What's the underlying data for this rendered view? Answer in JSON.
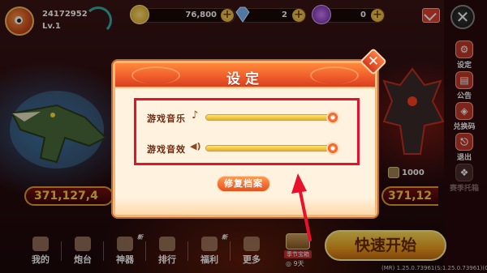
{
  "player": {
    "id": "24172952",
    "level": "Lv.1"
  },
  "currencies": [
    {
      "icon": "gold-coin-icon",
      "value": "76,800",
      "color": "#f0c020"
    },
    {
      "icon": "diamond-icon",
      "value": "2",
      "color": "#7ab8ff"
    },
    {
      "icon": "purple-gem-icon",
      "value": "0",
      "color": "#9a40d0"
    }
  ],
  "plus_glyph": "+",
  "side_menu": [
    {
      "icon": "gear-icon",
      "glyph": "⚙",
      "label": "设定"
    },
    {
      "icon": "announcement-icon",
      "glyph": "▤",
      "label": "公告"
    },
    {
      "icon": "redeem-code-icon",
      "glyph": "◈",
      "label": "兑换码"
    },
    {
      "icon": "exit-icon",
      "glyph": "⎋",
      "label": "退出"
    },
    {
      "icon": "season-icon",
      "glyph": "❖",
      "label": "赛季托箱"
    }
  ],
  "close_glyph": "✕",
  "payouts": {
    "left": "371,127,4",
    "right": "371,12",
    "small": "1000"
  },
  "dialog": {
    "title": "设定",
    "close_glyph": "✕",
    "music_label": "游戏音乐",
    "music_icon_glyph": "♪",
    "music_level": 1.0,
    "sfx_label": "游戏音效",
    "sfx_icon_glyph": "◀)",
    "sfx_level": 1.0,
    "repair_button": "修复档案"
  },
  "bottom_nav": [
    {
      "icon": "profile-icon",
      "label": "我的",
      "new": ""
    },
    {
      "icon": "turret-icon",
      "label": "炮台",
      "new": ""
    },
    {
      "icon": "artifact-icon",
      "label": "神器",
      "new": "新"
    },
    {
      "icon": "ranking-icon",
      "label": "排行",
      "new": ""
    },
    {
      "icon": "welfare-icon",
      "label": "福利",
      "new": "新"
    },
    {
      "icon": "more-icon",
      "label": "更多",
      "new": ""
    }
  ],
  "chest": {
    "tag": "季节宝箱",
    "days": "◎ 9天"
  },
  "quick_start": "快速开始",
  "version": "(MR) 1.25.0.73961(S:1.25.0.73961)(C:645)",
  "colors": {
    "highlight": "#e8102a",
    "dialog_header": "#ee5a2a",
    "dialog_body": "#fff3e0"
  }
}
